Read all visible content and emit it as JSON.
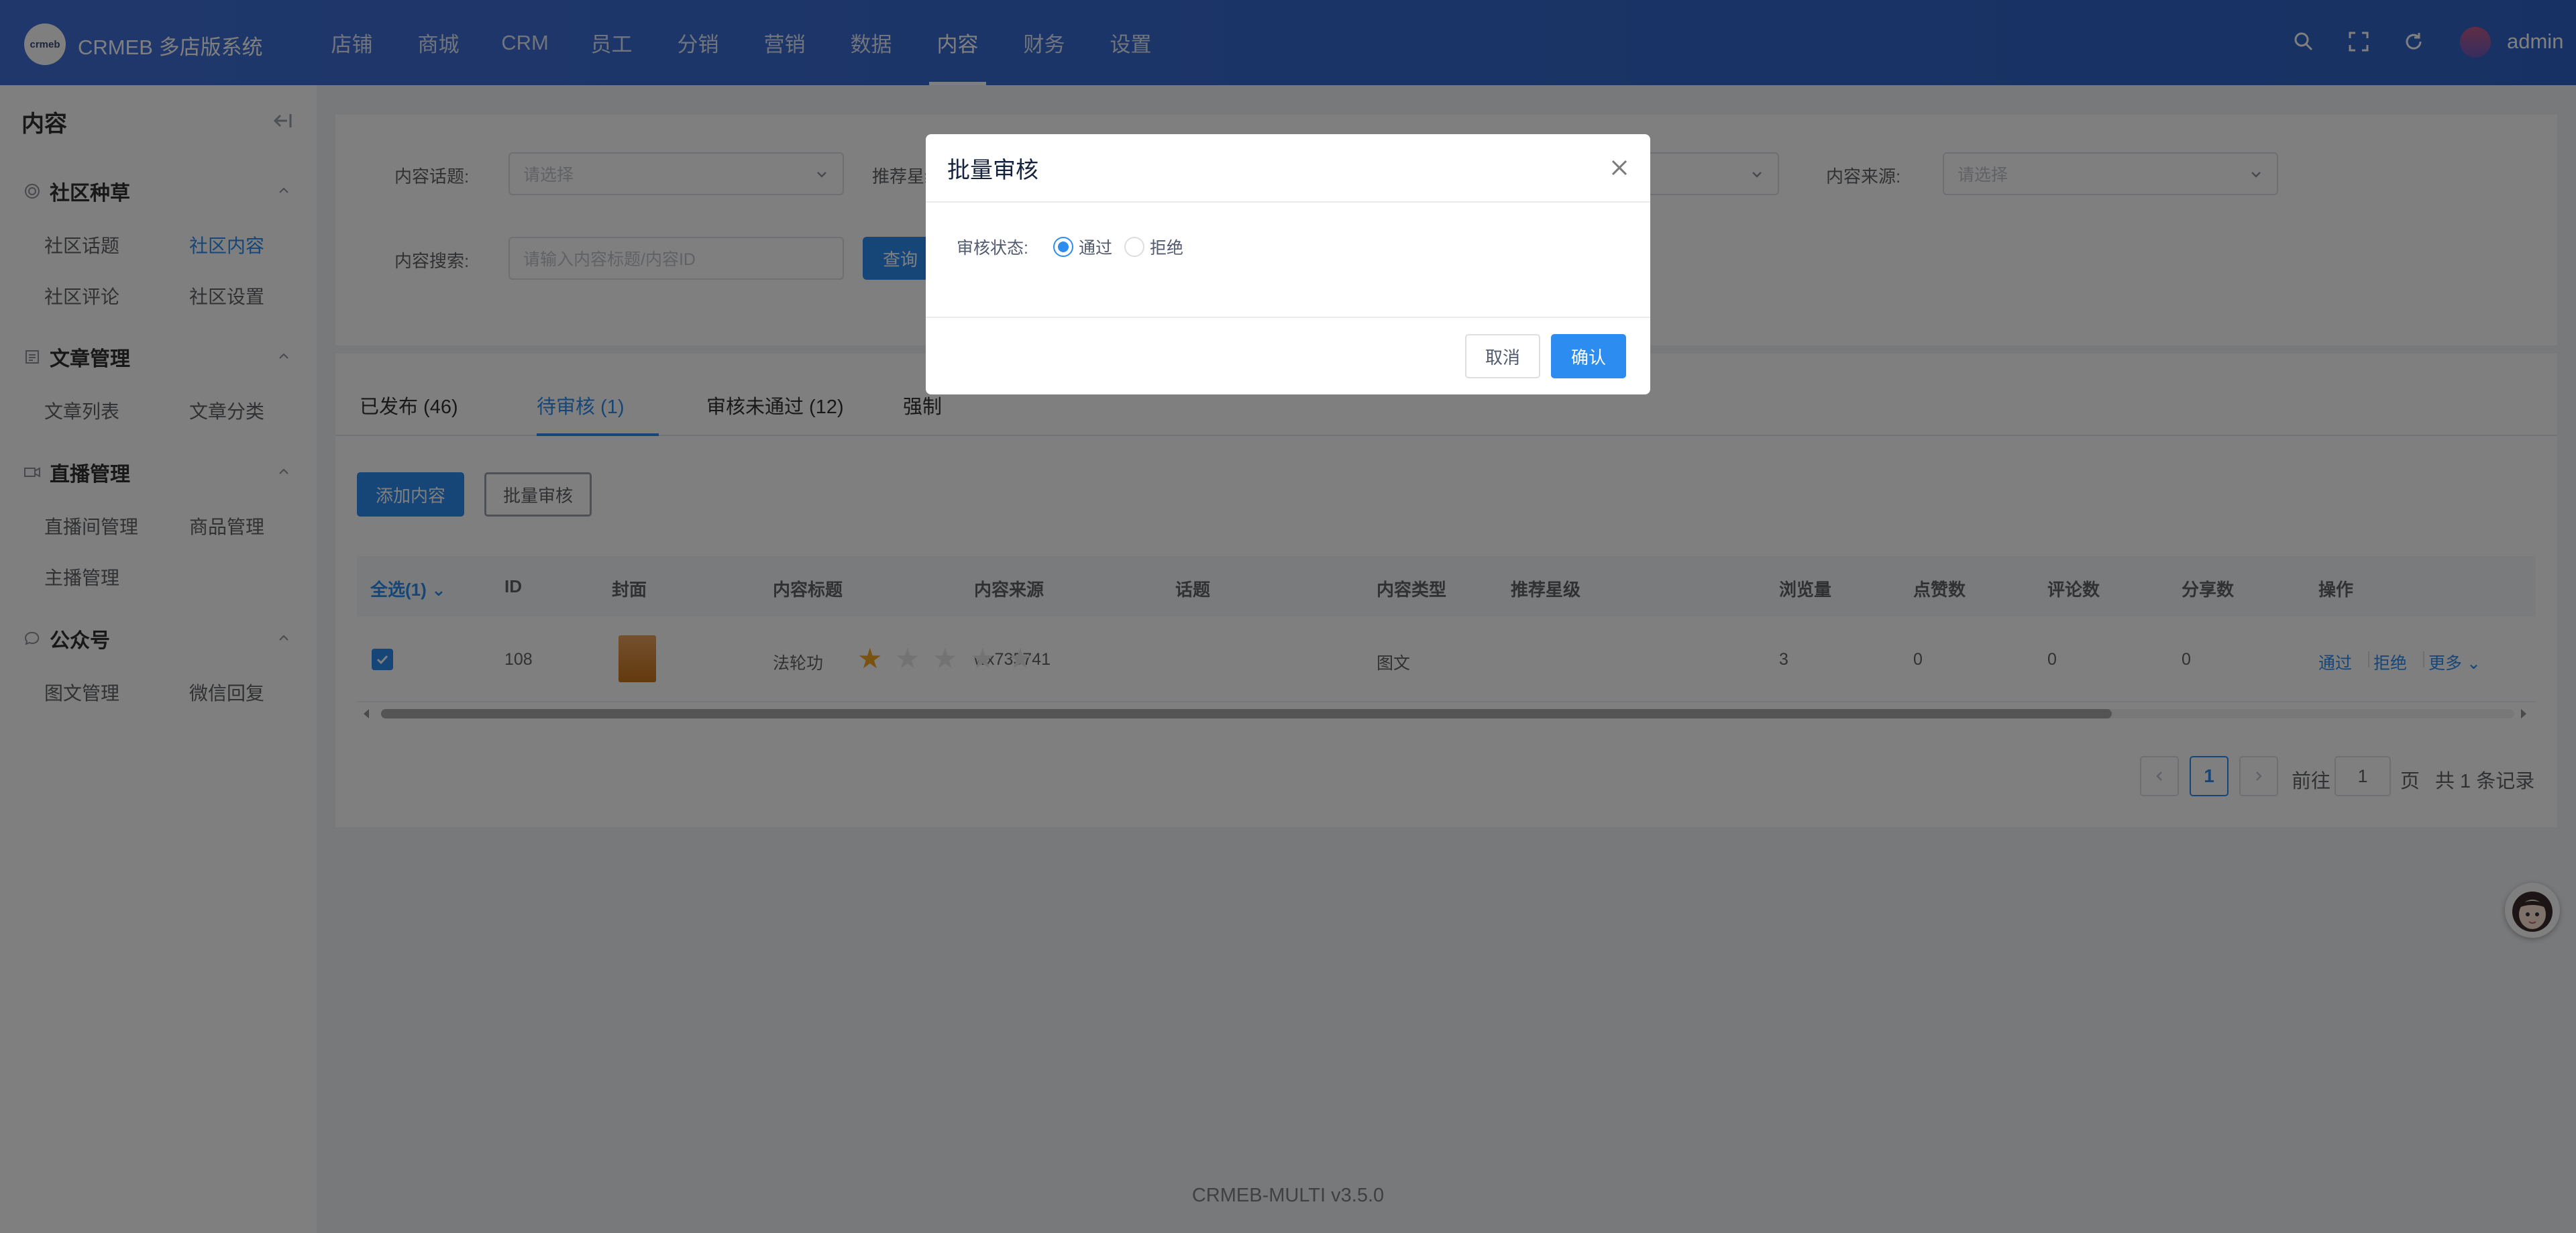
{
  "header": {
    "logo_text": "crmeb",
    "brand": "CRMEB 多店版系统",
    "nav": [
      "店铺",
      "商城",
      "CRM",
      "员工",
      "分销",
      "营销",
      "数据",
      "内容",
      "财务",
      "设置"
    ],
    "active_nav": "内容",
    "user": "admin"
  },
  "sidebar": {
    "title": "内容",
    "groups": [
      {
        "title": "社区种草",
        "icon": "target-icon",
        "items": [
          "社区话题",
          "社区内容",
          "社区评论",
          "社区设置"
        ]
      },
      {
        "title": "文章管理",
        "icon": "document-icon",
        "items": [
          "文章列表",
          "文章分类"
        ]
      },
      {
        "title": "直播管理",
        "icon": "video-icon",
        "items": [
          "直播间管理",
          "商品管理",
          "主播管理"
        ]
      },
      {
        "title": "公众号",
        "icon": "chat-icon",
        "items": [
          "图文管理",
          "微信回复"
        ]
      }
    ],
    "active_item": "社区内容"
  },
  "filters": {
    "topic_label": "内容话题:",
    "topic_placeholder": "请选择",
    "star_label": "推荐星级",
    "source_label": "内容来源:",
    "source_placeholder": "请选择",
    "search_label": "内容搜索:",
    "search_placeholder": "请输入内容标题/内容ID",
    "query_button": "查询"
  },
  "tabs": [
    "已发布 (46)",
    "待审核 (1)",
    "审核未通过 (12)",
    "强制"
  ],
  "active_tab": "待审核 (1)",
  "actions": {
    "add": "添加内容",
    "batch": "批量审核"
  },
  "table": {
    "select_all": "全选(1)",
    "columns": [
      "ID",
      "封面",
      "内容标题",
      "内容来源",
      "话题",
      "内容类型",
      "推荐星级",
      "浏览量",
      "点赞数",
      "评论数",
      "分享数",
      "操作"
    ],
    "rows": [
      {
        "id": "108",
        "title": "法轮功",
        "source": "wx735741",
        "topic": "",
        "type": "图文",
        "stars": 1,
        "stars_max": 5,
        "views": "3",
        "likes": "0",
        "comments": "0",
        "shares": "0"
      }
    ],
    "row_actions": [
      "通过",
      "拒绝",
      "更多"
    ]
  },
  "pagination": {
    "current": "1",
    "goto_prefix": "前往",
    "goto_value": "1",
    "goto_suffix": "页",
    "total": "共 1 条记录"
  },
  "footer": {
    "version": "CRMEB-MULTI v3.5.0"
  },
  "dialog": {
    "title": "批量审核",
    "status_label": "审核状态:",
    "options": [
      "通过",
      "拒绝"
    ],
    "selected": "通过",
    "cancel": "取消",
    "confirm": "确认"
  },
  "colors": {
    "primary": "#2d8cf0",
    "header": "#3366cc",
    "star_on": "#f5a623",
    "star_off": "#e0e0e0"
  }
}
